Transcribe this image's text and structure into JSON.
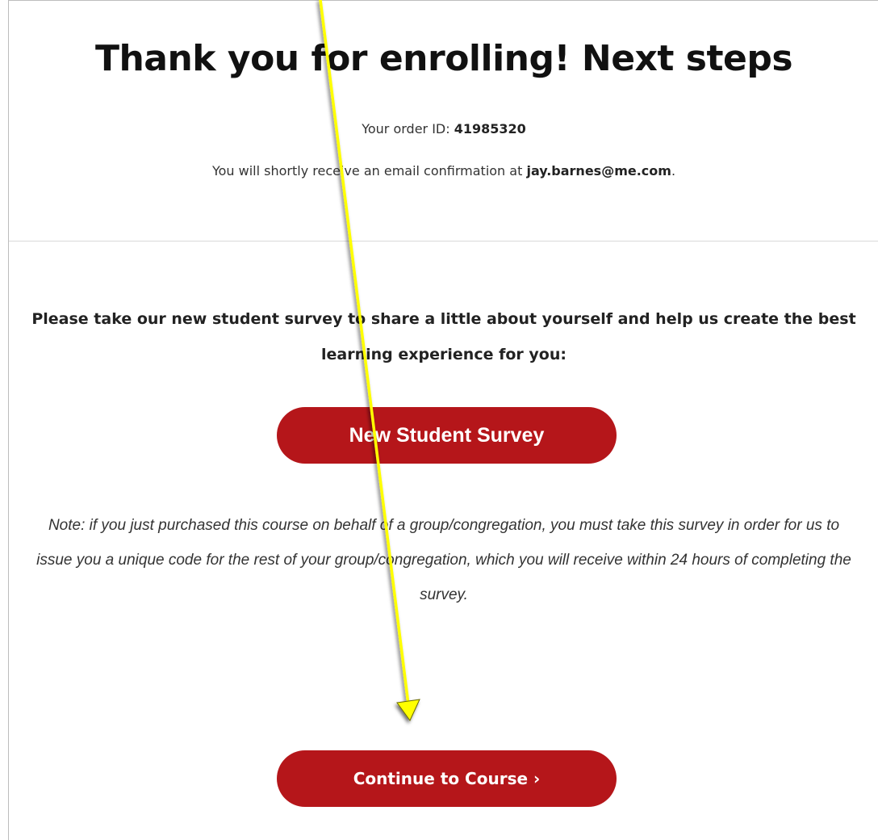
{
  "header": {
    "title": "Thank you for enrolling! Next steps",
    "order_label": "Your order ID: ",
    "order_id": "41985320",
    "email_prefix": "You will shortly receive an email confirmation at ",
    "email": "jay.barnes@me.com",
    "email_suffix": "."
  },
  "survey": {
    "prompt": "Please take our new student survey to share a little about yourself and help us create the best learning experience for you:",
    "button_label": "New Student Survey",
    "note": "Note: if you just purchased this course on behalf of a group/congregation, you must take this survey in order for us to issue you a unique code for the rest of your group/congregation, which you will receive within 24 hours of completing the survey."
  },
  "continue": {
    "button_label": "Continue to Course ›"
  },
  "colors": {
    "button_bg": "#b5161a",
    "annotation_arrow": "#ffff00"
  },
  "annotation": {
    "icon": "pointer-arrow-icon"
  }
}
